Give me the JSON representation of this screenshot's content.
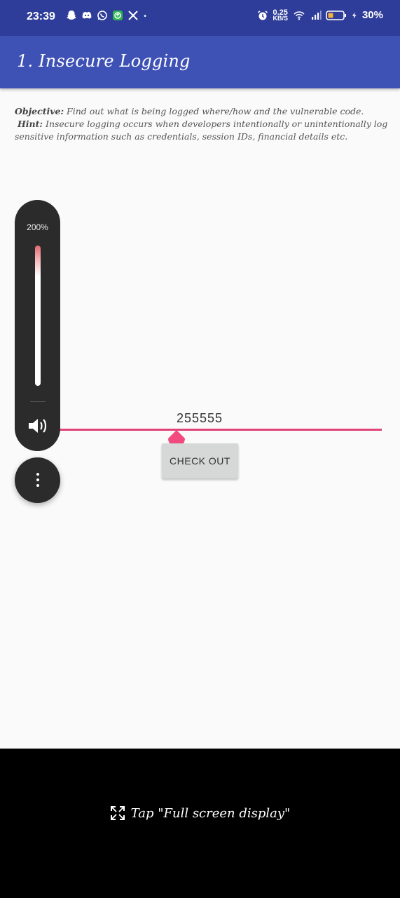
{
  "status_bar": {
    "time": "23:39",
    "network_speed_value": "0.25",
    "network_speed_unit": "KB/S",
    "battery": "30%",
    "notification_icons": [
      "snapchat-icon",
      "discord-icon",
      "whatsapp-icon",
      "app-update-icon",
      "x-icon",
      "dot-icon"
    ],
    "right_icons": [
      "alarm-icon",
      "wifi-icon",
      "signal-icon",
      "battery-icon",
      "charging-icon"
    ]
  },
  "app_bar": {
    "title": "1. Insecure Logging"
  },
  "description": {
    "objective_label": "Objective:",
    "objective_text": " Find out what is being logged where/how and the vulnerable code.",
    "hint_label": "Hint:",
    "hint_text_line1": " Insecure logging occurs when developers intentionally or unintentionally log",
    "hint_text_line2": "sensitive information such as credentials, session IDs, financial details etc."
  },
  "seekbar": {
    "value": "255555",
    "accent": "#e0427a"
  },
  "checkout_button": {
    "label": "CHECK OUT"
  },
  "volume_overlay": {
    "percent": "200%",
    "level_fraction": 1.0
  },
  "fullscreen_hint": {
    "text": "Tap \"Full screen display\""
  },
  "colors": {
    "primary": "#3e51b5",
    "primary_dark": "#2f3d9a",
    "accent": "#e0427a"
  }
}
